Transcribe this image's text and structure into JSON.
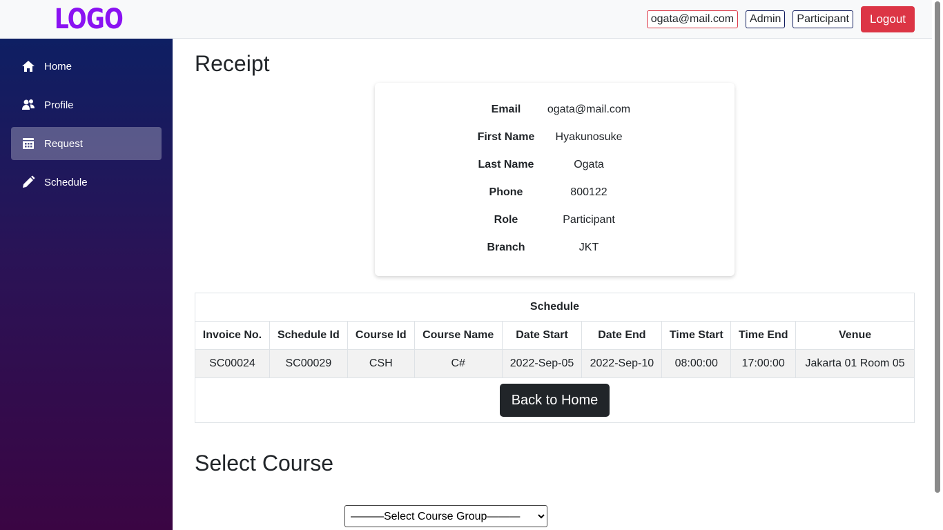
{
  "logo": "LOGO",
  "header": {
    "email": "ogata@mail.com",
    "roles": [
      "Admin",
      "Participant"
    ],
    "logout_label": "Logout"
  },
  "sidebar": {
    "items": [
      {
        "label": "Home",
        "icon": "home-icon"
      },
      {
        "label": "Profile",
        "icon": "users-icon"
      },
      {
        "label": "Request",
        "icon": "calendar-icon",
        "active": true
      },
      {
        "label": "Schedule",
        "icon": "pencil-icon"
      }
    ]
  },
  "receipt": {
    "title": "Receipt",
    "fields": [
      {
        "label": "Email",
        "value": "ogata@mail.com"
      },
      {
        "label": "First Name",
        "value": "Hyakunosuke"
      },
      {
        "label": "Last Name",
        "value": "Ogata"
      },
      {
        "label": "Phone",
        "value": "800122"
      },
      {
        "label": "Role",
        "value": "Participant"
      },
      {
        "label": "Branch",
        "value": "JKT"
      }
    ]
  },
  "schedule": {
    "caption": "Schedule",
    "columns": [
      "Invoice No.",
      "Schedule Id",
      "Course Id",
      "Course Name",
      "Date Start",
      "Date End",
      "Time Start",
      "Time End",
      "Venue"
    ],
    "rows": [
      [
        "SC00024",
        "SC00029",
        "CSH",
        "C#",
        "2022-Sep-05",
        "2022-Sep-10",
        "08:00:00",
        "17:00:00",
        "Jakarta 01 Room 05"
      ]
    ],
    "back_label": "Back to Home"
  },
  "select_course": {
    "title": "Select Course",
    "group_placeholder": "———Select Course Group———"
  }
}
